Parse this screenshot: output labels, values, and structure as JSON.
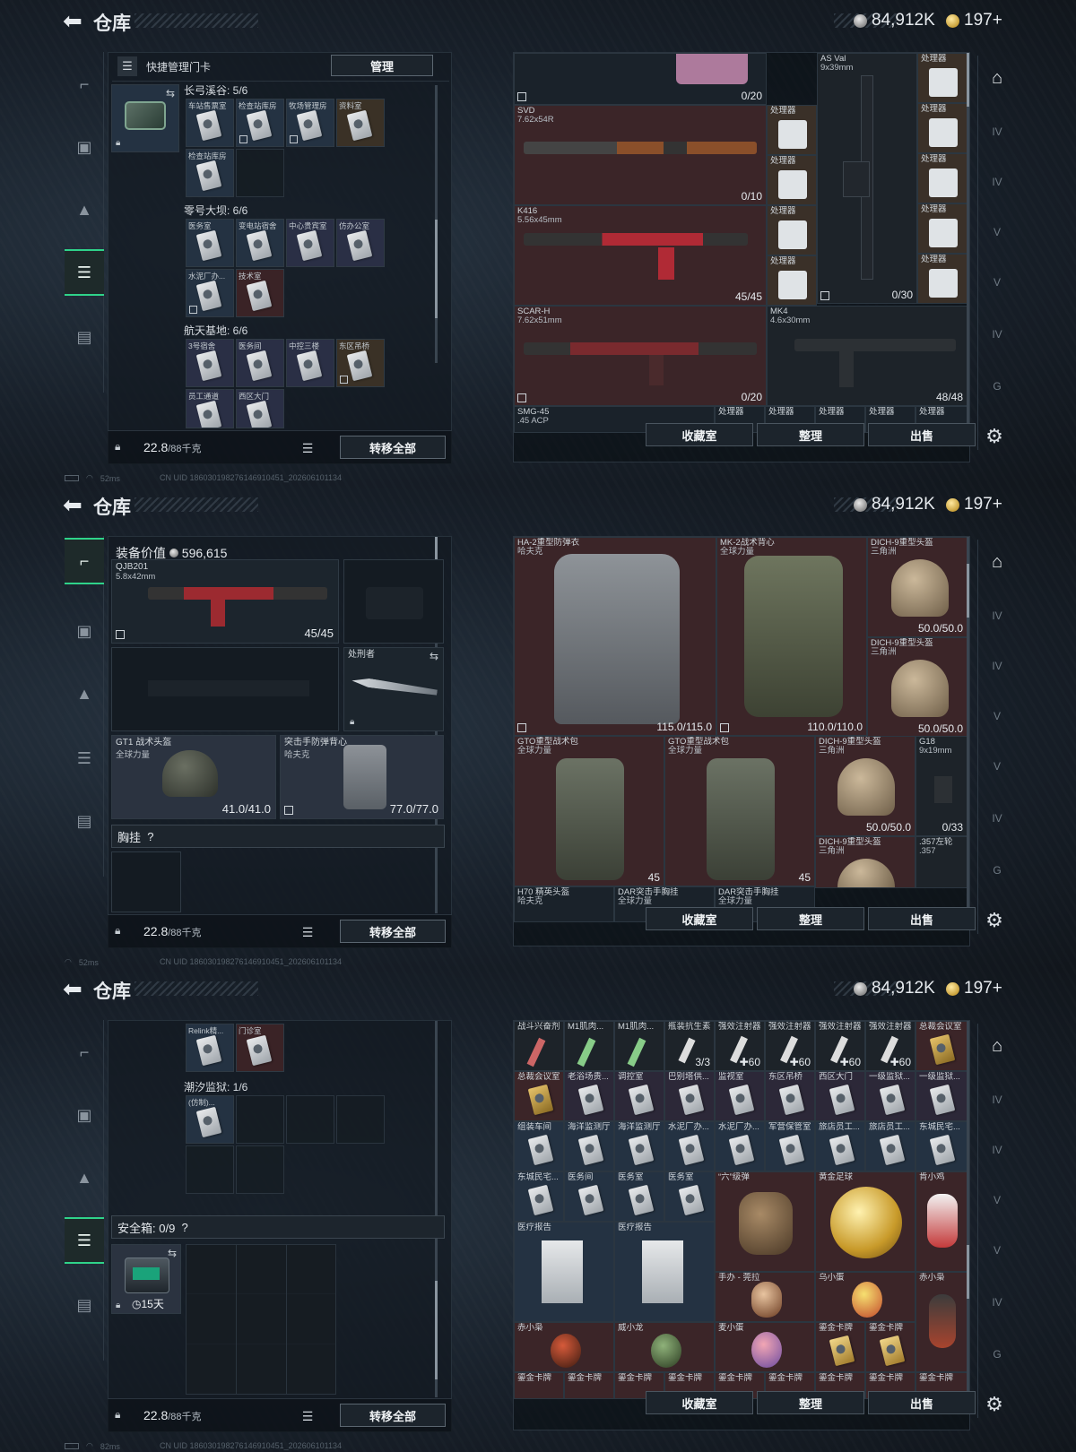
{
  "app": {
    "title": "仓库",
    "currency_silver": "84,912K",
    "currency_gold": "197+"
  },
  "status": {
    "ping": "52ms",
    "ping3": "82ms",
    "uid": "CN UID 18603019827614691045‌1_202606101134"
  },
  "bottom": {
    "weight": "22.8",
    "weight_unit": "/88千克",
    "transfer_all": "转移全部"
  },
  "right_buttons": {
    "collection": "收藏室",
    "sort": "整理",
    "sell": "出售"
  },
  "screen1": {
    "header_label": "快捷管理门卡",
    "manage_button": "管理",
    "sections": [
      {
        "title": "长弓溪谷: 5/6",
        "cards": [
          "车站售票室",
          "检查站库房",
          "牧场管理房",
          "资料室",
          "检查站库房"
        ]
      },
      {
        "title": "零号大坝: 6/6",
        "cards": [
          "医务室",
          "变电站宿舍",
          "中心贵宾室",
          "仿办公室",
          "水泥厂办...",
          "技术室"
        ]
      },
      {
        "title": "航天基地: 6/6",
        "cards": [
          "3号宿舍",
          "医务间",
          "中控三楼",
          "东区吊桥",
          "员工通道",
          "西区大门"
        ]
      }
    ],
    "items": [
      {
        "name": "",
        "sub": "",
        "count": "0/20"
      },
      {
        "name": "AS Val",
        "sub": "9x39mm",
        "count": "0/30"
      },
      {
        "name": "SVD",
        "sub": "7.62x54R",
        "count": "0/10"
      },
      {
        "name": "K416",
        "sub": "5.56x45mm",
        "count": "45/45"
      },
      {
        "name": "SCAR-H",
        "sub": "7.62x51mm",
        "count": "0/20"
      },
      {
        "name": "MK4",
        "sub": "4.6x30mm",
        "count": "48/48"
      },
      {
        "name": "SMG-45",
        "sub": ".45 ACP",
        "count": ""
      }
    ],
    "processor_label": "处理器"
  },
  "screen2": {
    "equip_value_label": "装备价值",
    "equip_value": "596,615",
    "primary": {
      "name": "QJB201",
      "sub": "5.8x42mm",
      "count": "45/45"
    },
    "knife": "处刑者",
    "helmet": {
      "name": "GT1 战术头盔",
      "sub": "全球力量",
      "count": "41.0/41.0"
    },
    "vest": {
      "name": "突击手防弹背心",
      "sub": "哈夫克",
      "count": "77.0/77.0"
    },
    "chest_rig": "胸挂",
    "chest_q": "?",
    "items": [
      {
        "name": "HA-2重型防弹衣",
        "sub": "哈夫克",
        "count": "115.0/115.0"
      },
      {
        "name": "MK-2战术背心",
        "sub": "全球力量",
        "count": "110.0/110.0"
      },
      {
        "name": "DICH-9重型头盔",
        "sub": "三角洲",
        "count": "50.0/50.0"
      },
      {
        "name": "DICH-9重型头盔",
        "sub": "三角洲",
        "count": "50.0/50.0"
      },
      {
        "name": "GTO重型战术包",
        "sub": "全球力量",
        "count": "45"
      },
      {
        "name": "GTO重型战术包",
        "sub": "全球力量",
        "count": "45"
      },
      {
        "name": "DICH-9重型头盔",
        "sub": "三角洲",
        "count": "50.0/50.0"
      },
      {
        "name": "G18",
        "sub": "9x19mm",
        "count": "0/33"
      },
      {
        "name": "DICH-9重型头盔",
        "sub": "三角洲",
        "count": ""
      },
      {
        "name": ".357左轮",
        "sub": ".357",
        "count": ""
      },
      {
        "name": "H70 精英头盔",
        "sub": "哈夫克",
        "count": ""
      },
      {
        "name": "DAR突击手胸挂",
        "sub": "全球力量",
        "count": ""
      },
      {
        "name": "DAR突击手胸挂",
        "sub": "全球力量",
        "count": ""
      }
    ]
  },
  "screen3": {
    "prison_title": "潮汐监狱: 1/6",
    "top_cards": [
      "Relink精...",
      "门诊室"
    ],
    "prison_card": "(仿制)...",
    "safe_box": "安全箱: 0/9",
    "safe_q": "?",
    "safe_timer": "15天",
    "row1": [
      {
        "name": "战斗兴奋剂",
        "count": ""
      },
      {
        "name": "M1肌肉...",
        "count": ""
      },
      {
        "name": "M1肌肉...",
        "count": ""
      },
      {
        "name": "瓶装抗生素",
        "count": "3/3"
      },
      {
        "name": "强效注射器",
        "count": "60"
      },
      {
        "name": "强效注射器",
        "count": "60"
      },
      {
        "name": "强效注射器",
        "count": "60"
      },
      {
        "name": "强效注射器",
        "count": "60"
      },
      {
        "name": "总裁会议室",
        "count": ""
      }
    ],
    "row2": [
      "总裁会议室",
      "老浴场贵...",
      "调控室",
      "巴别塔供...",
      "监视室",
      "东区吊桥",
      "西区大门",
      "一级监狱...",
      "一级监狱..."
    ],
    "row3": [
      "组装车间",
      "海洋监测厅",
      "海洋监测厅",
      "水泥厂办...",
      "水泥厂办...",
      "军营保管室",
      "旅店员工...",
      "旅店员工...",
      "东城民宅..."
    ],
    "row4": [
      "东城民宅...",
      "医务间",
      "医务室",
      "医务室"
    ],
    "big_items": [
      "“六”级弹",
      "黄金足球",
      "肯小鸡"
    ],
    "reports": [
      "医疗报告",
      "医疗报告"
    ],
    "figures": [
      "手办 - 莞拉",
      "乌小蛋",
      "赤小枭",
      "赤小枭",
      "威小龙",
      "麦小蛋",
      "鎏金卡牌",
      "鎏金卡牌"
    ],
    "last_row": [
      "鎏金卡牌",
      "鎏金卡牌",
      "鎏金卡牌",
      "鎏金卡牌",
      "鎏金卡牌",
      "鎏金卡牌",
      "鎏金卡牌",
      "鎏金卡牌",
      "鎏金卡牌"
    ]
  }
}
